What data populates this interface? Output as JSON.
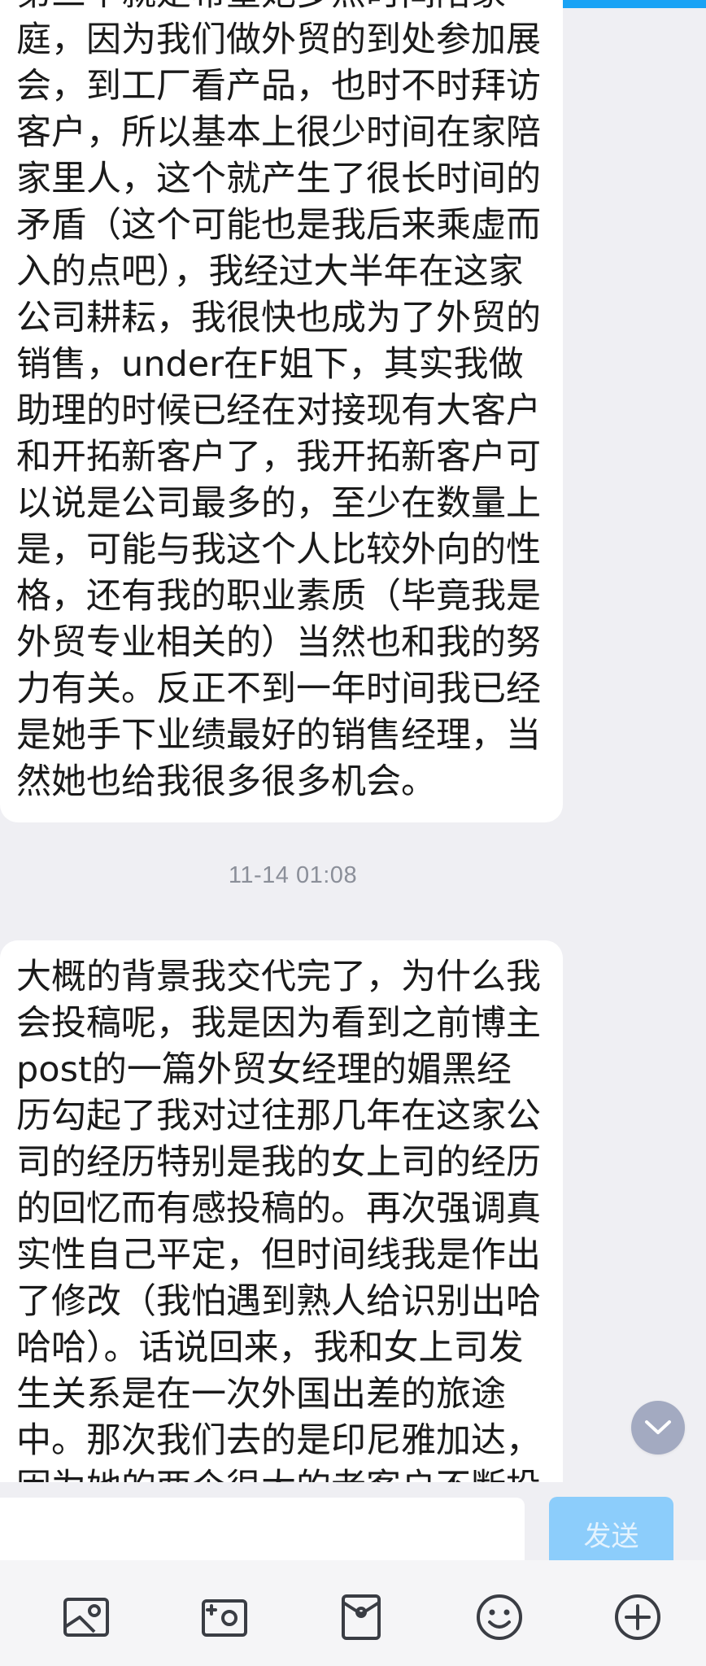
{
  "messages": [
    {
      "lines": [
        "第三个就是希望她多点时间陪家",
        "庭，因为我们做外贸的到处参加展",
        "会，到工厂看产品，也时不时拜访",
        "客户，所以基本上很少时间在家陪",
        "家里人，这个就产生了很长时间的",
        "矛盾（这个可能也是我后来乘虚而",
        "入的点吧），我经过大半年在这家",
        "公司耕耘，我很快也成为了外贸的",
        "销售，under在F姐下，其实我做",
        "助理的时候已经在对接现有大客户",
        "和开拓新客户了，我开拓新客户可",
        "以说是公司最多的，至少在数量上",
        "是，可能与我这个人比较外向的性",
        "格，还有我的职业素质（毕竟我是",
        "外贸专业相关的）当然也和我的努",
        "力有关。反正不到一年时间我已经",
        "是她手下业绩最好的销售经理，当",
        "然她也给我很多很多机会。"
      ]
    },
    {
      "lines": [
        "大概的背景我交代完了，为什么我",
        "会投稿呢，我是因为看到之前博主",
        "post的一篇外贸女经理的媚黑经",
        "历勾起了我对过往那几年在这家公",
        "司的经历特别是我的女上司的经历",
        "的回忆而有感投稿的。再次强调真",
        "实性自己平定，但时间线我是作出",
        "了修改（我怕遇到熟人给识别出哈",
        "哈哈）。话说回来，我和女上司发",
        "生关系是在一次外国出差的旅途",
        "中。那次我们去的是印尼雅加达，",
        "因为她的两个很大的老客户不断投"
      ]
    }
  ],
  "timestamp": "11-14 01:08",
  "input": {
    "value": "",
    "placeholder": ""
  },
  "send_label": "发送",
  "toolbar_icons": [
    "image-icon",
    "camera-icon",
    "envelope-icon",
    "emoji-icon",
    "plus-circle-icon"
  ],
  "colors": {
    "background": "#efeff3",
    "bubble": "#ffffff",
    "send_disabled": "#8ccdfb",
    "accent": "#1aa3f5",
    "icon": "#3a3d44"
  }
}
